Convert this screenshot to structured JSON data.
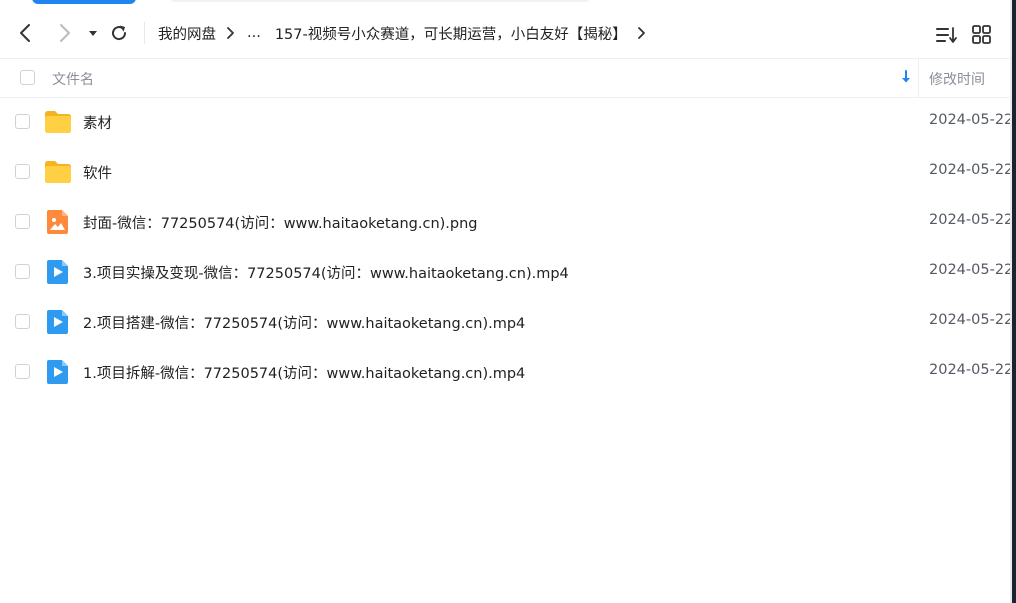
{
  "toolbar": {
    "back_icon": "chevron-left-icon",
    "forward_icon": "chevron-right-icon",
    "history_icon": "caret-down-icon",
    "refresh_icon": "refresh-icon",
    "breadcrumbs": [
      "我的网盘",
      "...",
      "157-视频号小众赛道，可长期运营，小白友好【揭秘】"
    ],
    "sort_icon": "sort-list-icon",
    "view_icon": "grid-view-icon"
  },
  "header": {
    "name_label": "文件名",
    "modified_label": "修改时间",
    "sort_icon": "sort-down-arrow-icon"
  },
  "files": [
    {
      "name": "素材",
      "type": "folder",
      "modified": "2024-05-22"
    },
    {
      "name": "软件",
      "type": "folder",
      "modified": "2024-05-22"
    },
    {
      "name": "封面-微信：77250574(访问：www.haitaoketang.cn).png",
      "type": "image",
      "modified": "2024-05-22"
    },
    {
      "name": "3.项目实操及变现-微信：77250574(访问：www.haitaoketang.cn).mp4",
      "type": "video",
      "modified": "2024-05-22"
    },
    {
      "name": "2.项目搭建-微信：77250574(访问：www.haitaoketang.cn).mp4",
      "type": "video",
      "modified": "2024-05-22"
    },
    {
      "name": "1.项目拆解-微信：77250574(访问：www.haitaoketang.cn).mp4",
      "type": "video",
      "modified": "2024-05-22"
    }
  ],
  "colors": {
    "folder": "#fbc02d",
    "image": "#ff8a3d",
    "video": "#2e9bf0",
    "accent": "#1f86ef"
  }
}
